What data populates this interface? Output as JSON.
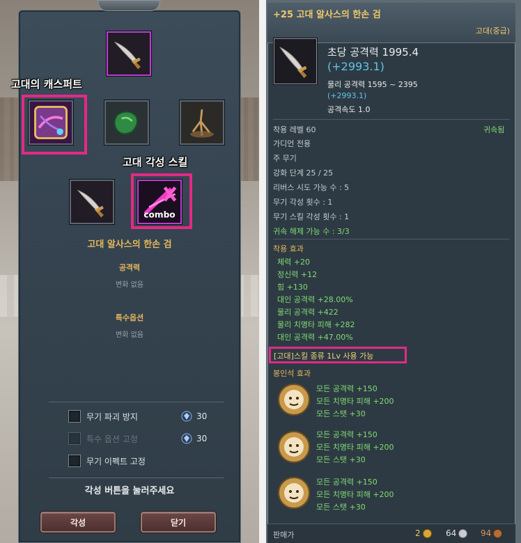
{
  "left_panel": {
    "captions": {
      "ancient_capsule": "고대의 캐스퍼트",
      "awakening_skill": "고대 각성 스킬"
    },
    "combo_icon_text": "combo",
    "item_name": "고대 알사스의 한손 검",
    "stats": [
      {
        "heading": "공격력",
        "value": "변화 없음"
      },
      {
        "heading": "특수옵션",
        "value": "변화 없음"
      }
    ],
    "options": [
      {
        "label": "무기 파괴 방지",
        "cost": "30",
        "disabled": false
      },
      {
        "label": "특수 옵션 고정",
        "cost": "30",
        "disabled": true
      },
      {
        "label": "무기 이펙트 고정",
        "cost": "",
        "disabled": false
      }
    ],
    "guide_text": "각성 버튼을 눌러주세요",
    "buttons": {
      "awaken": "각성",
      "close": "닫기"
    },
    "highlight_color": "#e22a86"
  },
  "tooltip": {
    "title": "+25 고대 알사스의 한손 검",
    "grade": "고대(중급)",
    "dps_label": "초당 공격력 1995.4",
    "dps_bonus": "(+2993.1)",
    "phys_attack": "물리 공격력 1595 ~ 2395",
    "phys_bonus": "(+2993.1)",
    "attack_speed": "공격속도 1.0",
    "req_level": "착용 레벨 60",
    "bound": "귀속됨",
    "class_only": "가디언 전용",
    "slot_type": "주 무기",
    "enhance": "강화 단계 25 / 25",
    "reverse": "리버스 시도 가능 수 : 5",
    "weapon_awaken": "무기 각성 횟수 : 1",
    "skill_awaken": "무기 스킬 각성 횟수 : 1",
    "unbind": "귀속 해제 가능 수 : 3/3",
    "equip_effect_title": "착용 효과",
    "equip_effects": [
      "체력 +20",
      "정신력 +12",
      "힘 +130",
      "대인 공격력 +28.00%",
      "물리 공격력 +422",
      "물리 치명타 피해 +282",
      "대인 공격력 +47.00%"
    ],
    "skill_notice": "[고대]스킬 종류 1Lv 사용 가능",
    "rune_title": "봉인석 효과",
    "runes": [
      {
        "lines": [
          "모든 공격력 +150",
          "모든 치명타 피해 +200",
          "모든 스탯 +30"
        ]
      },
      {
        "lines": [
          "모든 공격력 +150",
          "모든 치명타 피해 +200",
          "모든 스탯 +30"
        ]
      },
      {
        "lines": [
          "모든 공격력 +150",
          "모든 치명타 피해 +200",
          "모든 스탯 +30"
        ]
      }
    ],
    "sell_label": "판매가",
    "price": {
      "gold": "2",
      "silver": "64",
      "copper": "94"
    }
  },
  "colors": {
    "gold_text": "#e3b45a",
    "cyan_text": "#60c4e8",
    "green_text": "#7fdc74",
    "highlight": "#e22a86"
  }
}
